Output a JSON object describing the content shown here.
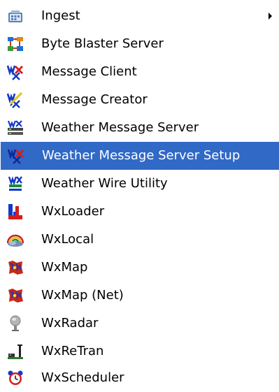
{
  "menu": {
    "items": [
      {
        "label": "Ingest",
        "icon": "program-group-folder-icon",
        "has_submenu": true,
        "selected": false
      },
      {
        "label": "Byte Blaster Server",
        "icon": "byte-blaster-server-icon",
        "selected": false
      },
      {
        "label": "Message Client",
        "icon": "wx-message-client-icon",
        "selected": false
      },
      {
        "label": "Message Creator",
        "icon": "wx-message-creator-icon",
        "selected": false
      },
      {
        "label": "Weather Message Server",
        "icon": "wx-message-server-icon",
        "selected": false
      },
      {
        "label": "Weather Message Server Setup",
        "icon": "wx-server-setup-icon",
        "selected": true
      },
      {
        "label": "Weather Wire Utility",
        "icon": "weather-wire-utility-icon",
        "selected": false
      },
      {
        "label": "WxLoader",
        "icon": "wxloader-icon",
        "selected": false
      },
      {
        "label": "WxLocal",
        "icon": "wxlocal-rainbow-icon",
        "selected": false
      },
      {
        "label": "WxMap",
        "icon": "wxmap-icon",
        "selected": false
      },
      {
        "label": "WxMap (Net)",
        "icon": "wxmap-net-icon",
        "selected": false
      },
      {
        "label": "WxRadar",
        "icon": "wxradar-dish-icon",
        "selected": false
      },
      {
        "label": "WxReTran",
        "icon": "wxretran-tower-icon",
        "selected": false
      },
      {
        "label": "WxScheduler",
        "icon": "wxscheduler-alarm-clock-icon",
        "selected": false
      }
    ]
  },
  "colors": {
    "selection_background": "#3169c6",
    "selection_text": "#ffffff",
    "menu_background": "#ffffff",
    "text": "#000000"
  }
}
